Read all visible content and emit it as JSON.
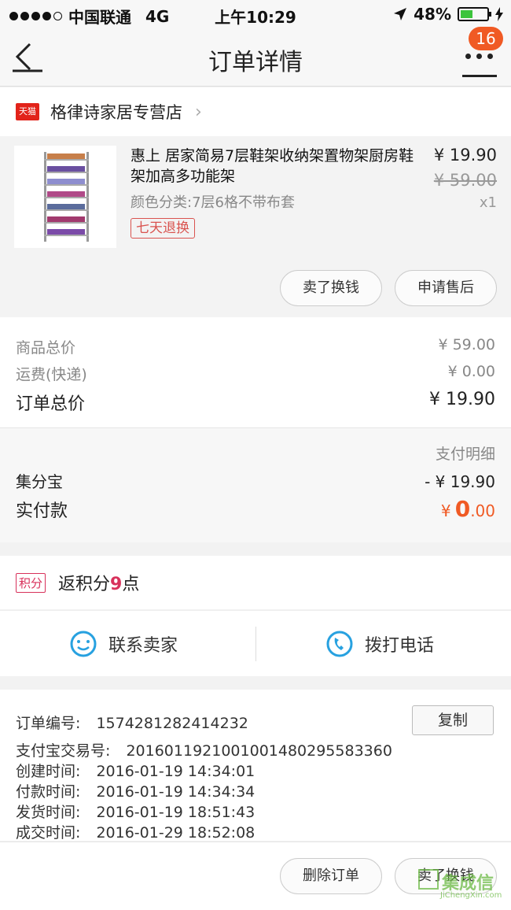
{
  "status_bar": {
    "carrier": "中国联通",
    "network": "4G",
    "time": "上午10:29",
    "battery": "48%",
    "battery_level": 0.48
  },
  "nav": {
    "title": "订单详情",
    "badge_count": "16"
  },
  "shop": {
    "logo_text": "天猫",
    "name": "格律诗家居专营店"
  },
  "product": {
    "title": "惠上 居家简易7层鞋架收纳架置物架厨房鞋架加高多功能架",
    "sku": "颜色分类:7层6格不带布套",
    "tag": "七天退换",
    "price": "¥ 19.90",
    "original_price": "¥ 59.00",
    "quantity": "x1",
    "actions": [
      "卖了换钱",
      "申请售后"
    ]
  },
  "summary": {
    "items_label": "商品总价",
    "items_value": "¥ 59.00",
    "shipping_label": "运费(快递)",
    "shipping_value": "¥ 0.00",
    "total_label": "订单总价",
    "total_value": "¥ 19.90"
  },
  "payment": {
    "detail_label": "支付明细",
    "discount_label": "集分宝",
    "discount_value": "- ¥ 19.90",
    "paid_label": "实付款",
    "paid_currency": "¥",
    "paid_int": "0",
    "paid_dec": ".00",
    "accent_color": "#f05a24"
  },
  "points": {
    "badge": "积分",
    "text_prefix": "返积分",
    "value": "9",
    "text_suffix": "点"
  },
  "contact": {
    "seller_label": "联系卖家",
    "call_label": "拨打电话"
  },
  "order_info": {
    "order_no_label": "订单编号:",
    "order_no": "1574281282414232",
    "copy_label": "复制",
    "alipay_label": "支付宝交易号:",
    "alipay_no": "2016011921001001480295583360",
    "created_label": "创建时间:",
    "created": "2016-01-19 14:34:01",
    "paid_label": "付款时间:",
    "paid": "2016-01-19 14:34:34",
    "shipped_label": "发货时间:",
    "shipped": "2016-01-19 18:51:43",
    "done_label": "成交时间:",
    "done": "2016-01-29 18:52:08"
  },
  "bottom_actions": [
    "删除订单",
    "卖了换钱"
  ],
  "watermark": {
    "cn": "集成信",
    "en": "JiChengXin.com"
  }
}
